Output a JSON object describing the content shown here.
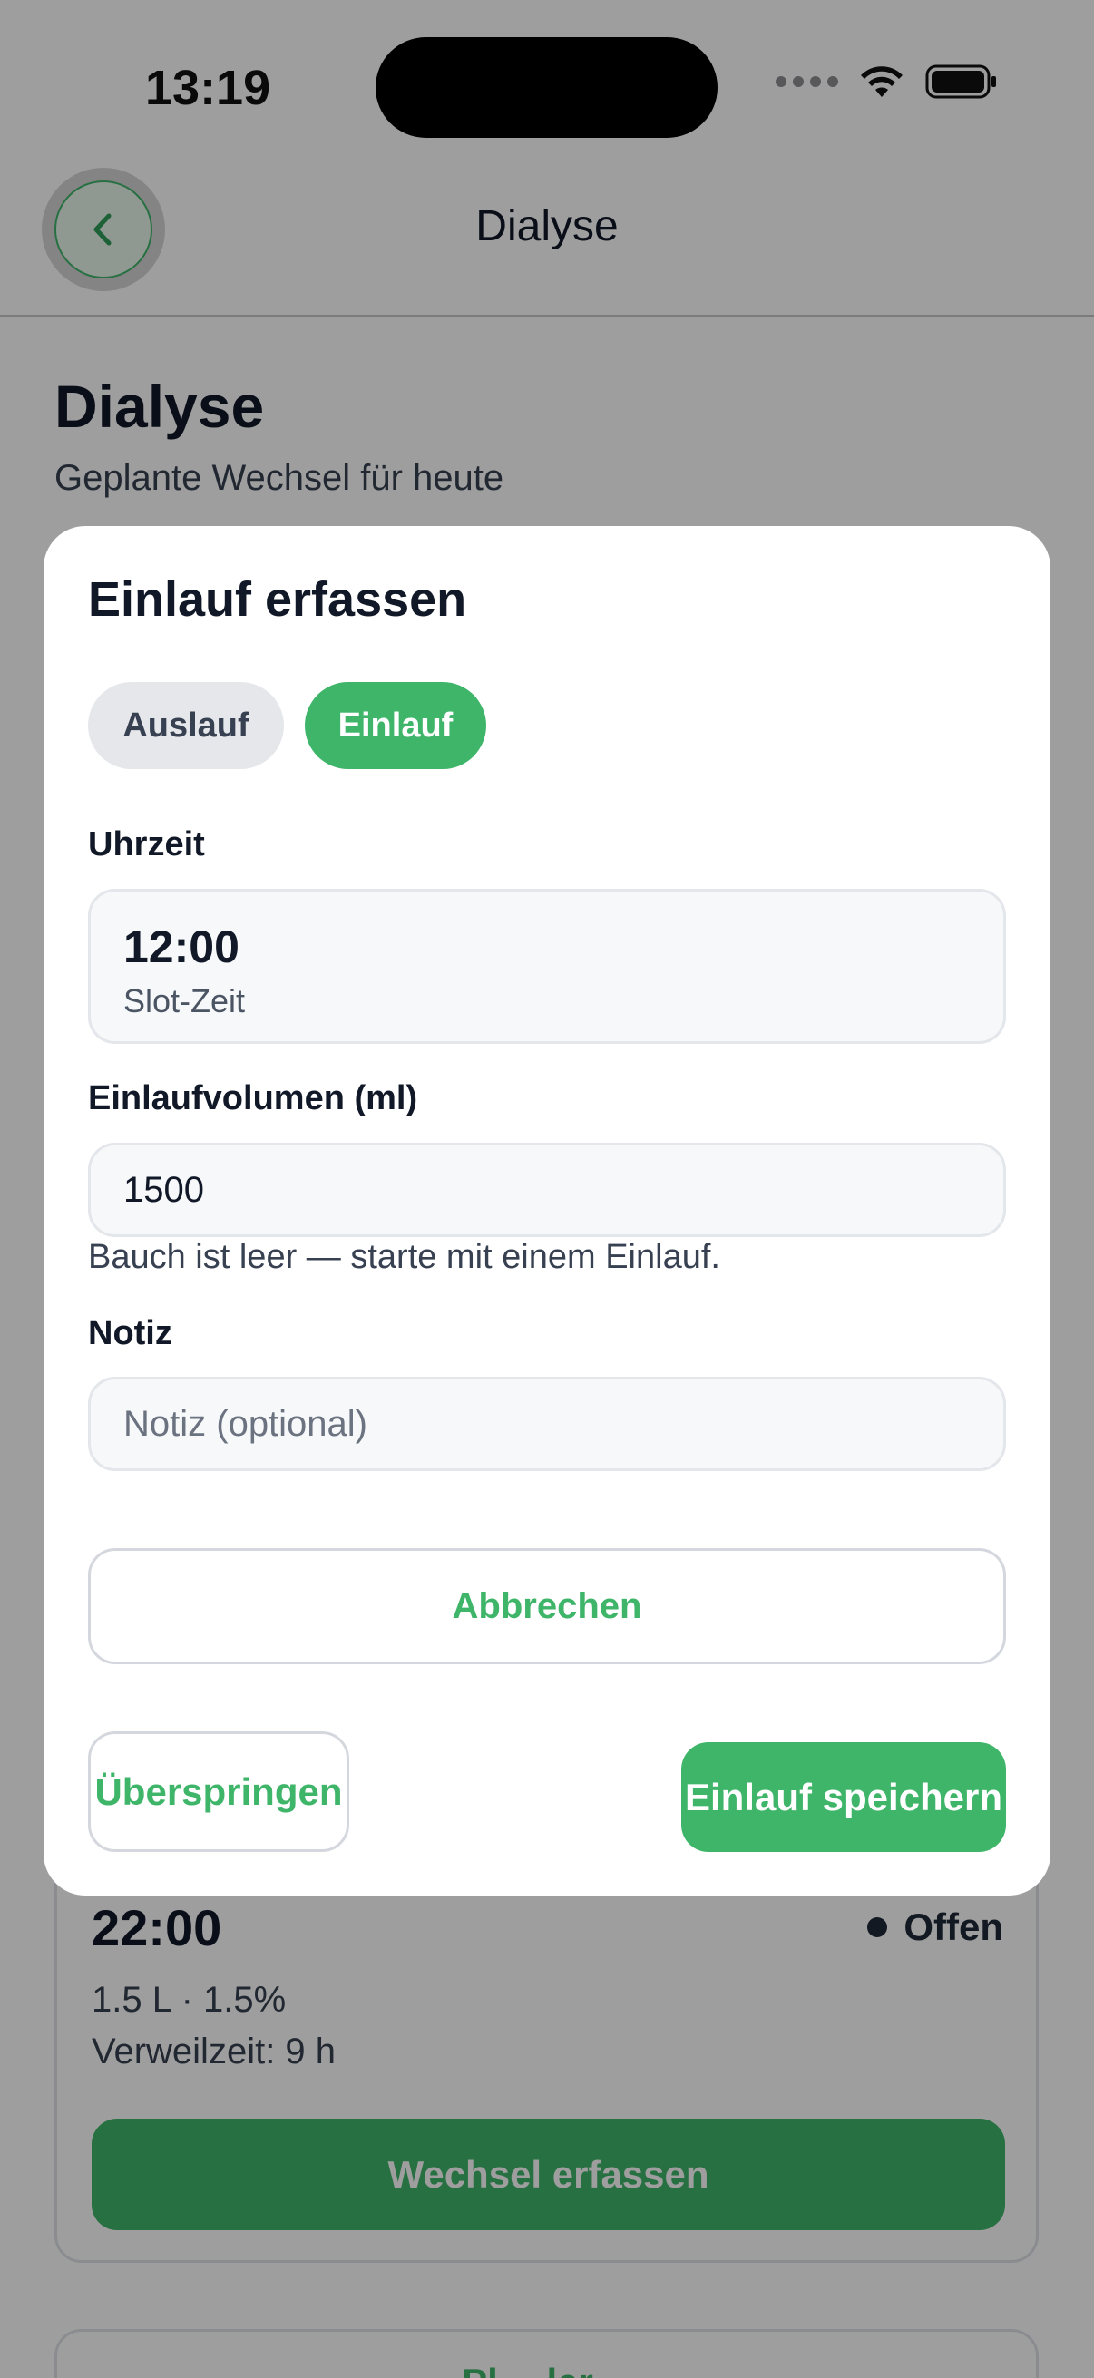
{
  "status_bar": {
    "time": "13:19"
  },
  "nav": {
    "title": "Dialyse"
  },
  "page": {
    "title": "Dialyse",
    "subtitle": "Geplante Wechsel für heute"
  },
  "slot_card": {
    "time": "22:00",
    "status": "Offen",
    "volume_concentration": "1.5 L · 1.5%",
    "dwell_time": "Verweilzeit: 9 h",
    "record_button": "Wechsel erfassen"
  },
  "next_card": {
    "button_label": "Pl… ler…"
  },
  "modal": {
    "title": "Einlauf erfassen",
    "segments": [
      "Auslauf",
      "Einlauf"
    ],
    "selected_segment": "Einlauf",
    "time_label": "Uhrzeit",
    "time_value": "12:00",
    "time_caption": "Slot-Zeit",
    "volume_label": "Einlaufvolumen (ml)",
    "volume_value": "1500",
    "hint": "Bauch ist leer — starte mit einem Einlauf.",
    "note_label": "Notiz",
    "note_placeholder": "Notiz (optional)",
    "cancel_label": "Abbrechen",
    "skip_label": "Überspringen",
    "save_label": "Einlauf speichern"
  },
  "colors": {
    "accent": "#3fb56a",
    "text": "#111827",
    "overlay": "rgba(0,0,0,0.38)"
  },
  "icons": {
    "back": "chevron-left-icon",
    "wifi": "wifi-icon",
    "battery": "battery-icon",
    "signal": "signal-icon"
  }
}
